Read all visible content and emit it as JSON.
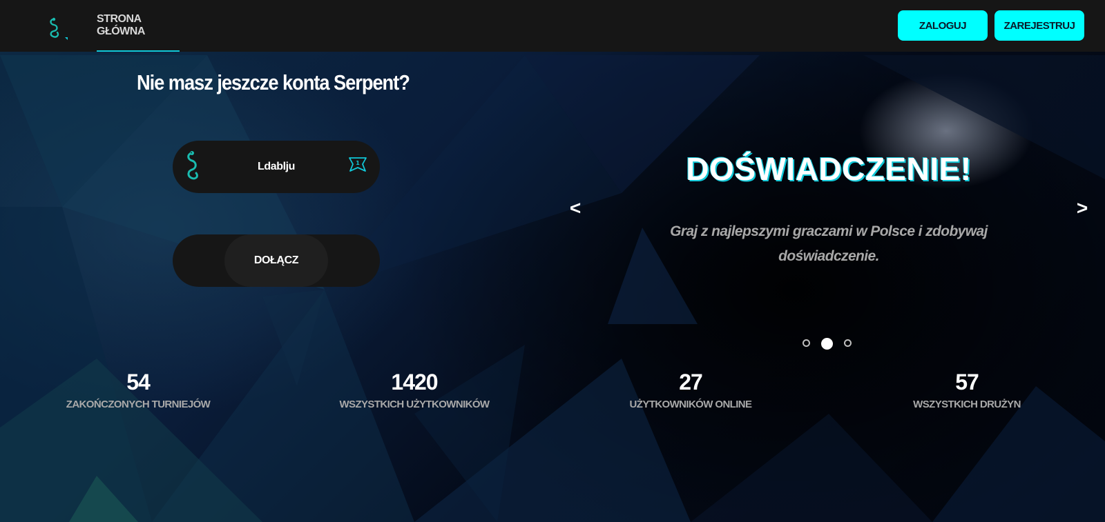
{
  "nav": {
    "logo_icon": "snake-icon",
    "home_label": "STRONA GŁÓWNA",
    "login_label": "ZALOGUJ",
    "register_label": "ZAREJESTRUJ",
    "accent_color": "#00ffff"
  },
  "join": {
    "title": "Nie masz jeszcze konta Serpent?",
    "username": "Ldablju",
    "rank_icon": "rank-badge-icon",
    "join_label": "DOŁĄCZ"
  },
  "carousel": {
    "prev_label": "<",
    "next_label": ">",
    "slide_title": "DOŚWIADCZENIE!",
    "slide_text": "Graj z najlepszymi graczami w Polsce i zdobywaj doświadczenie.",
    "slide_count": 3,
    "active_slide": 2
  },
  "stats": [
    {
      "value": "54",
      "label": "ZAKOŃCZONYCH TURNIEJÓW"
    },
    {
      "value": "1420",
      "label": "WSZYSTKICH UŻYTKOWNIKÓW"
    },
    {
      "value": "27",
      "label": "UŻYTKOWNIKÓW ONLINE"
    },
    {
      "value": "57",
      "label": "WSZYSTKICH DRUŻYN"
    }
  ]
}
